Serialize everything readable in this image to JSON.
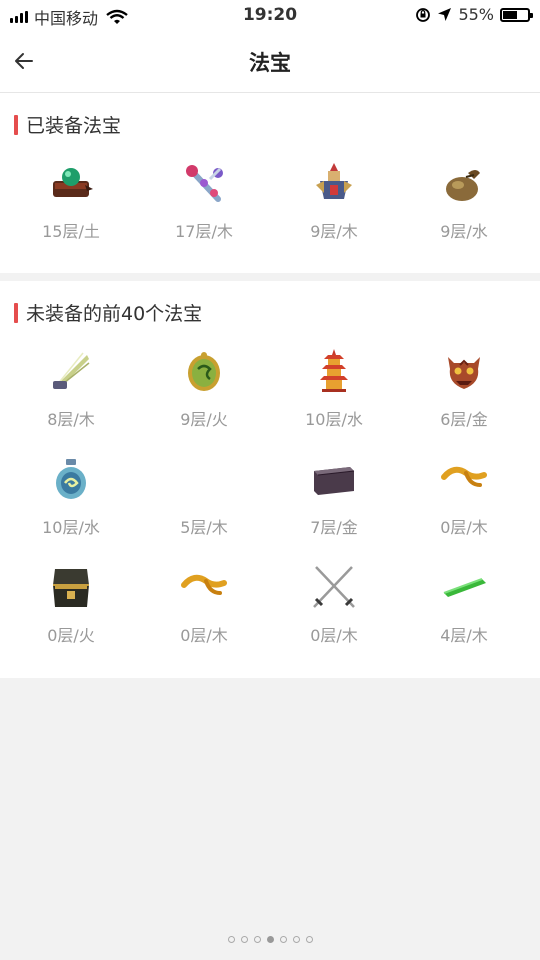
{
  "status": {
    "carrier": "中国移动",
    "time": "19:20",
    "battery": "55%"
  },
  "nav": {
    "title": "法宝"
  },
  "equipped": {
    "title": "已装备法宝",
    "items": [
      {
        "label": "15层/土",
        "icon": "green-gem-chest-icon"
      },
      {
        "label": "17层/木",
        "icon": "jeweled-scepter-icon"
      },
      {
        "label": "9层/木",
        "icon": "warrior-figurine-icon"
      },
      {
        "label": "9层/水",
        "icon": "treasure-pouch-icon"
      }
    ]
  },
  "unequipped": {
    "title": "未装备的前40个法宝",
    "items": [
      {
        "label": "8层/木",
        "icon": "feather-fan-icon"
      },
      {
        "label": "9层/火",
        "icon": "jade-token-icon"
      },
      {
        "label": "10层/水",
        "icon": "pagoda-tower-icon"
      },
      {
        "label": "6层/金",
        "icon": "demon-mask-icon"
      },
      {
        "label": "10层/水",
        "icon": "gourd-vase-icon"
      },
      {
        "label": "5层/木",
        "icon": ""
      },
      {
        "label": "7层/金",
        "icon": "dark-box-icon"
      },
      {
        "label": "0层/木",
        "icon": "golden-ribbon-icon"
      },
      {
        "label": "0层/火",
        "icon": "open-chest-icon"
      },
      {
        "label": "0层/木",
        "icon": "golden-ribbon-icon"
      },
      {
        "label": "0层/木",
        "icon": "crossed-swords-icon"
      },
      {
        "label": "4层/木",
        "icon": "green-bamboo-icon"
      }
    ]
  },
  "pager": {
    "count": 7,
    "active": 3
  }
}
